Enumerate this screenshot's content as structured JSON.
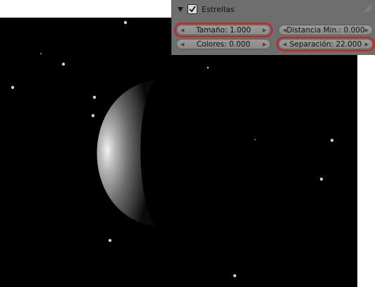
{
  "panel": {
    "title": "Estrellas",
    "enabled": true,
    "fields": {
      "size": "Tamaño: 1.000",
      "min_distance": "Distancia Min.: 0.000",
      "colors": "Colores: 0.000",
      "separation": "Separación: 22.000"
    }
  },
  "colors": {
    "panel_bg": "#6e6e6e",
    "field_bg": "#8f8f8f",
    "highlight": "#d41e1e",
    "render_bg": "#000000"
  }
}
